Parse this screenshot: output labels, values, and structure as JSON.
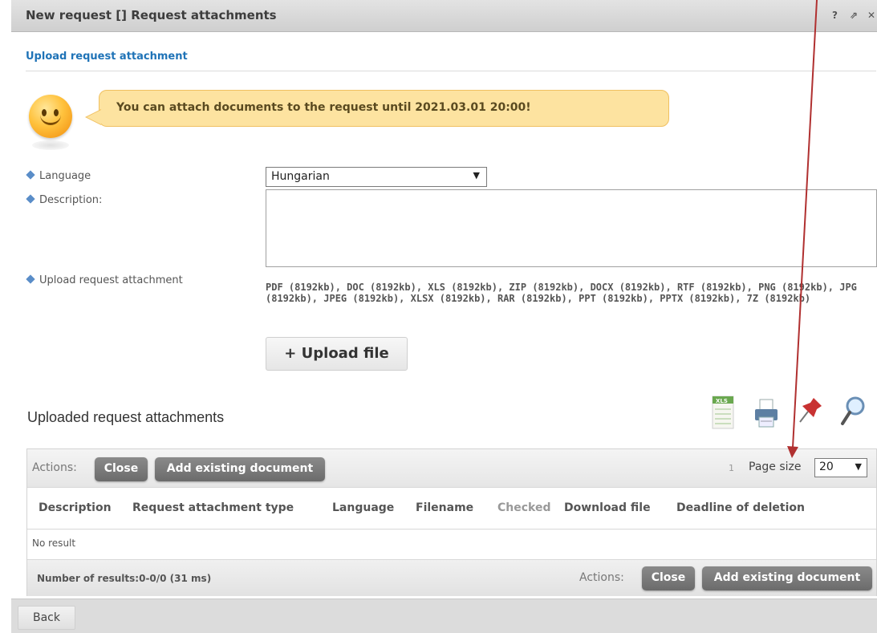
{
  "window": {
    "title": "New request [] Request attachments",
    "help_icon": "?",
    "popout_icon": "⇗",
    "close_icon": "✕"
  },
  "section": {
    "title": "Upload request attachment"
  },
  "notice": {
    "text": "You can attach documents to the request until 2021.03.01 20:00!",
    "icon": "smiley-icon"
  },
  "form": {
    "language_label": "Language",
    "language_value": "Hungarian",
    "description_label": "Description:",
    "upload_label": "Upload request attachment",
    "formats_text": "PDF (8192kb), DOC (8192kb), XLS (8192kb), ZIP (8192kb), DOCX (8192kb), RTF (8192kb), PNG (8192kb), JPG (8192kb), JPEG (8192kb), XLSX (8192kb), RAR (8192kb), PPT (8192kb), PPTX (8192kb), 7Z (8192kb)",
    "upload_button": "+ Upload file"
  },
  "uploaded": {
    "title": "Uploaded request attachments",
    "tools": [
      "excel-export-icon",
      "print-icon",
      "pin-icon",
      "search-icon"
    ]
  },
  "table": {
    "actions_label": "Actions:",
    "close_button": "Close",
    "add_existing_button": "Add existing document",
    "page_number": "1",
    "page_size_label": "Page size",
    "page_size_value": "20",
    "columns": [
      "Description",
      "Request attachment type",
      "Language",
      "Filename",
      "Checked",
      "Download file",
      "Deadline of deletion"
    ],
    "empty_text": "No result",
    "results_text": "Number of results:0-0/0 (31 ms)"
  },
  "footer": {
    "back_button": "Back"
  },
  "colors": {
    "accent": "#1f73b7",
    "notice_bg": "#fde3a0",
    "action_button": "#7a7a7a",
    "annotation_arrow": "#b03030"
  }
}
